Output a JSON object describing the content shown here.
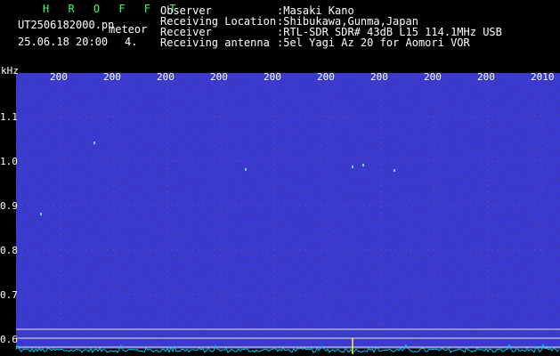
{
  "header": {
    "program": "H R O F F T",
    "filename": "UT2506182000.pn",
    "mode": "meteor",
    "datetime": "25.06.18 20:00",
    "channel": "4.",
    "meta": [
      {
        "label": "Observer",
        "value": ":Masaki Kano"
      },
      {
        "label": "Receiving Location",
        "value": ":Shibukawa,Gunma,Japan"
      },
      {
        "label": "Receiver",
        "value": ":RTL-SDR SDR# 43dB L15 114.1MHz USB"
      },
      {
        "label": "Receiving antenna",
        "value": ":5el Yagi Az 20 for Aomori VOR"
      }
    ]
  },
  "axis": {
    "unit": "kHz",
    "y_ticks": [
      "1.1",
      "1.0",
      "0.9",
      "0.8",
      "0.7",
      "0.6"
    ],
    "top_ticks": [
      "200",
      "200",
      "200",
      "200",
      "200",
      "200",
      "200",
      "200",
      "200",
      "2010"
    ]
  },
  "colors": {
    "background": "#000000",
    "waterfall": "#0c0c5a",
    "grid": "#b4b4b4",
    "spectrum": "#00c8ff",
    "marker": "#ffff00"
  }
}
